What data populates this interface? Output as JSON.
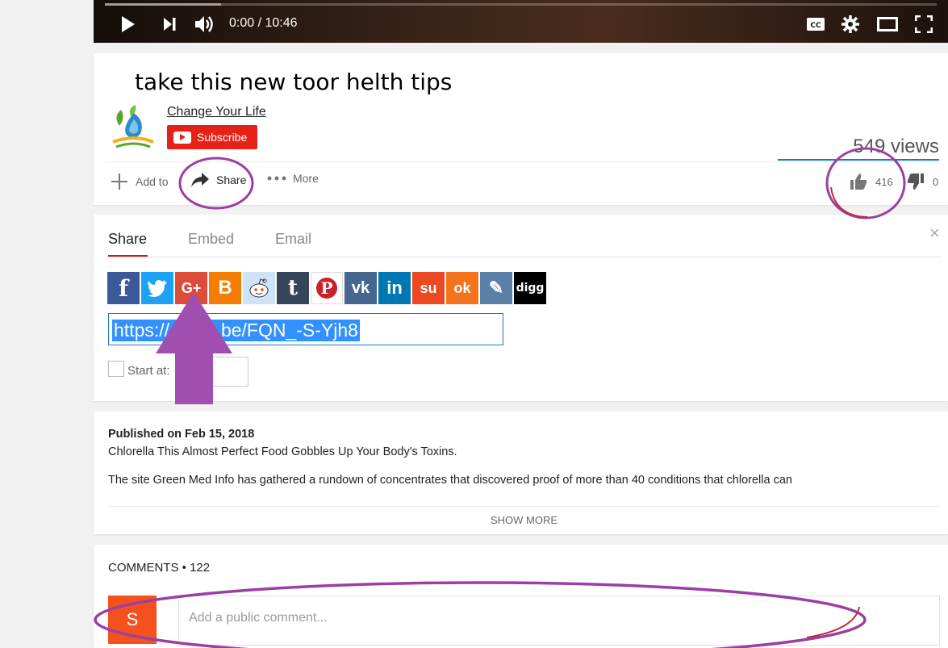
{
  "player": {
    "time": "0:00 / 10:46",
    "progress": 0.14,
    "controls": [
      "play-icon",
      "next-icon",
      "volume-icon",
      "captions-icon",
      "settings-icon",
      "theater-icon",
      "fullscreen-icon"
    ]
  },
  "video": {
    "title": "take this new toor helth tips",
    "channel": "Change Your Life",
    "subscribe_label": "Subscribe",
    "views": "549 views",
    "likes": "416",
    "dislikes": "0"
  },
  "actions": {
    "add_to": "Add to",
    "share": "Share",
    "more": "More"
  },
  "share_panel": {
    "tabs": [
      "Share",
      "Embed",
      "Email"
    ],
    "active_tab": "Share",
    "close": "×",
    "social": [
      {
        "name": "facebook",
        "glyph": "f",
        "color": "#3b5998"
      },
      {
        "name": "twitter",
        "glyph": "t",
        "color": "#1da1f2"
      },
      {
        "name": "google-plus",
        "glyph": "G+",
        "color": "#dd4b39"
      },
      {
        "name": "blogger",
        "glyph": "B",
        "color": "#f57d00"
      },
      {
        "name": "reddit",
        "glyph": "r",
        "color": "#cee3f8"
      },
      {
        "name": "tumblr",
        "glyph": "t",
        "color": "#35465c"
      },
      {
        "name": "pinterest",
        "glyph": "P",
        "color": "#ffffff"
      },
      {
        "name": "vk",
        "glyph": "vk",
        "color": "#45668e"
      },
      {
        "name": "linkedin",
        "glyph": "in",
        "color": "#0077b5"
      },
      {
        "name": "stumbleupon",
        "glyph": "su",
        "color": "#eb4924"
      },
      {
        "name": "odnoklassniki",
        "glyph": "ok",
        "color": "#f4731c"
      },
      {
        "name": "livejournal",
        "glyph": "✎",
        "color": "#5b7fa6"
      },
      {
        "name": "digg",
        "glyph": "digg",
        "color": "#000000"
      }
    ],
    "url": "https://      tu.be/FQN_-S-Yjh8",
    "start_at_label": "Start at:"
  },
  "description": {
    "published": "Published on Feb 15, 2018",
    "line1": "Chlorella This Almost Perfect Food Gobbles Up Your Body's Toxins.",
    "line2": "The site Green Med Info has gathered a rundown of concentrates that discovered proof of more than 40 conditions that chlorella can",
    "show_more": "SHOW MORE"
  },
  "comments": {
    "header": "COMMENTS • 122",
    "avatar_letter": "S",
    "placeholder": "Add a public comment..."
  },
  "colors": {
    "accent_red": "#e62117",
    "annotation_purple": "#9b3fa3",
    "link_blue": "#167ac6"
  }
}
